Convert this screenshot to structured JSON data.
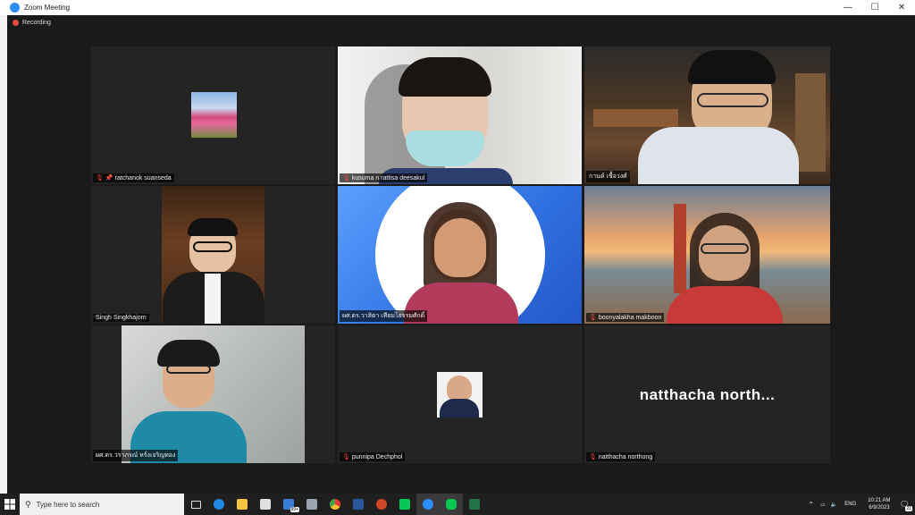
{
  "window": {
    "title": "Zoom Meeting",
    "controls": [
      "—",
      "☐",
      "✕"
    ]
  },
  "recording": {
    "label": "Recording"
  },
  "participants": [
    {
      "name": "ratchanok suanseda",
      "muted": true,
      "pinned": true
    },
    {
      "name": "kusuma n rattisa deesakul",
      "muted": true
    },
    {
      "name": "กานต์ เชื้อวงศ์",
      "muted": false,
      "active": true
    },
    {
      "name": "Singh Singkhajorn",
      "muted": false
    },
    {
      "name": "ผศ.ดร.วาสิตา เทียมไธรรมศักดิ์",
      "muted": true
    },
    {
      "name": "boonyalakha makboon",
      "muted": true
    },
    {
      "name": "ผศ.ดร.วราภรณ์ หรั่งเจริญทอง",
      "muted": false
    },
    {
      "name": "punnipa Dechphol",
      "muted": true
    },
    {
      "name": "natthacha northong",
      "muted": true,
      "display_name": "natthacha  north..."
    }
  ],
  "taskbar": {
    "search_placeholder": "Type here to search",
    "badge": "99+",
    "lang": "ENG",
    "time": "10:21 AM",
    "date": "6/9/2023",
    "notif": "21"
  }
}
